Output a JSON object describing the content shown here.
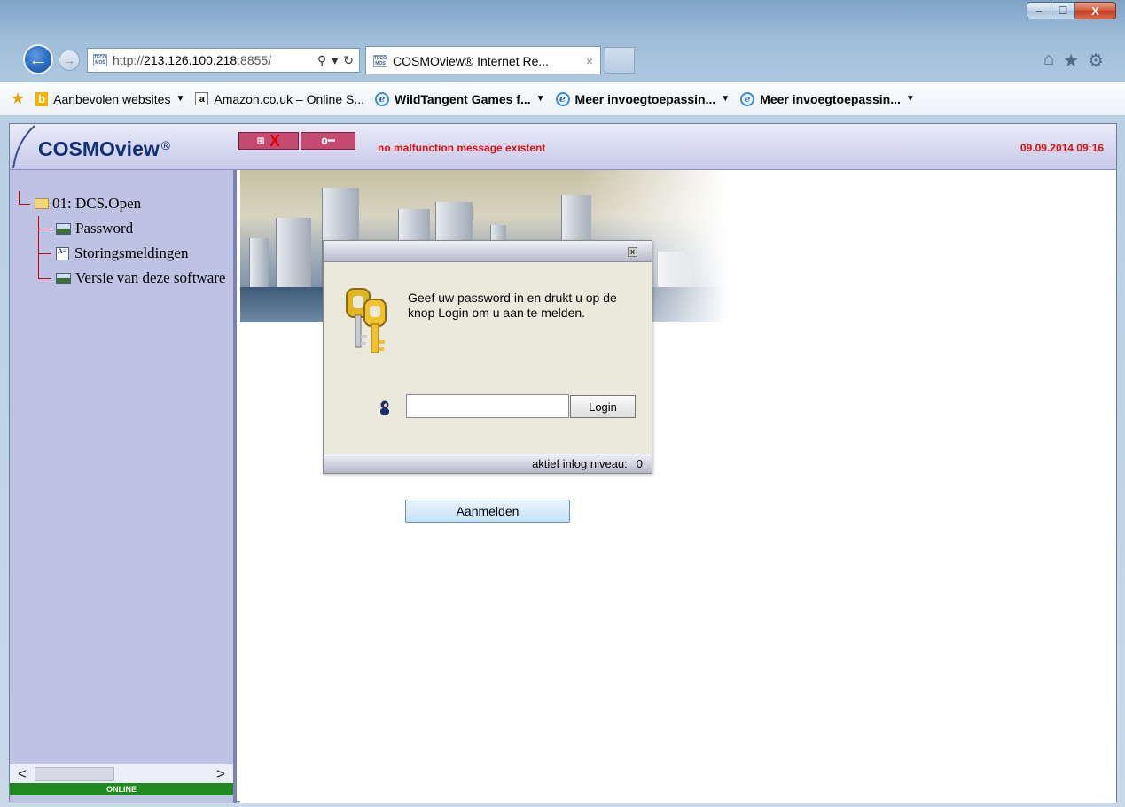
{
  "browser": {
    "url": "http://213.126.100.218:8855/",
    "url_prefix": "http://",
    "url_host": "213.126.100.218",
    "url_suffix": ":8855/",
    "tab_title": "COSMOview® Internet Re...",
    "tab_close": "×",
    "favicon_text": "TECOS MOS",
    "window_controls": {
      "minimize": "–",
      "maximize": "☐",
      "close": "X"
    },
    "nav_icons": {
      "back": "back-arrow-icon",
      "forward": "forward-arrow-icon",
      "search": "⚲",
      "dropdown": "▾",
      "refresh": "↻"
    },
    "right_icons": {
      "home": "⌂",
      "favorites": "★",
      "settings": "⚙"
    }
  },
  "favorites": [
    {
      "label": "Aanbevolen websites",
      "has_dropdown": true,
      "icon": "bing-icon",
      "bold": false
    },
    {
      "label": "Amazon.co.uk – Online S...",
      "has_dropdown": false,
      "icon": "amazon-icon",
      "bold": false
    },
    {
      "label": "WildTangent Games f...",
      "has_dropdown": true,
      "icon": "ie-icon",
      "bold": true
    },
    {
      "label": "Meer invoegtoepassin...",
      "has_dropdown": true,
      "icon": "ie-icon",
      "bold": true
    },
    {
      "label": "Meer invoegtoepassin...",
      "has_dropdown": true,
      "icon": "ie-icon",
      "bold": true
    }
  ],
  "app": {
    "brand": "COSMOview",
    "brand_reg": "®",
    "toolbar": {
      "tree_glyph": "⊞",
      "close_glyph": "X",
      "key_glyph": "o━"
    },
    "status_message": "no malfunction message existent",
    "datetime": "09.09.2014 09:16",
    "colors": {
      "status_red": "#e01010",
      "sidebar": "#bfc3e3",
      "online_green": "#1f8a1f"
    }
  },
  "tree": {
    "root": "01: DCS.Open",
    "children": [
      {
        "label": "Password",
        "icon": "screen-icon"
      },
      {
        "label": "Storingsmeldingen",
        "icon": "list-icon"
      },
      {
        "label": "Versie van deze software",
        "icon": "screen-icon"
      }
    ]
  },
  "sidebar": {
    "scroll_left": "<",
    "scroll_right": ">",
    "online": "ONLINE"
  },
  "dialog": {
    "close": "x",
    "message": "Geef uw password in en drukt u op de knop  Login  om u aan te melden.",
    "password_value": "",
    "login_button": "Login",
    "status_label": "aktief inlog niveau:",
    "status_value": "0"
  },
  "main": {
    "aanmelden_button": "Aanmelden"
  }
}
